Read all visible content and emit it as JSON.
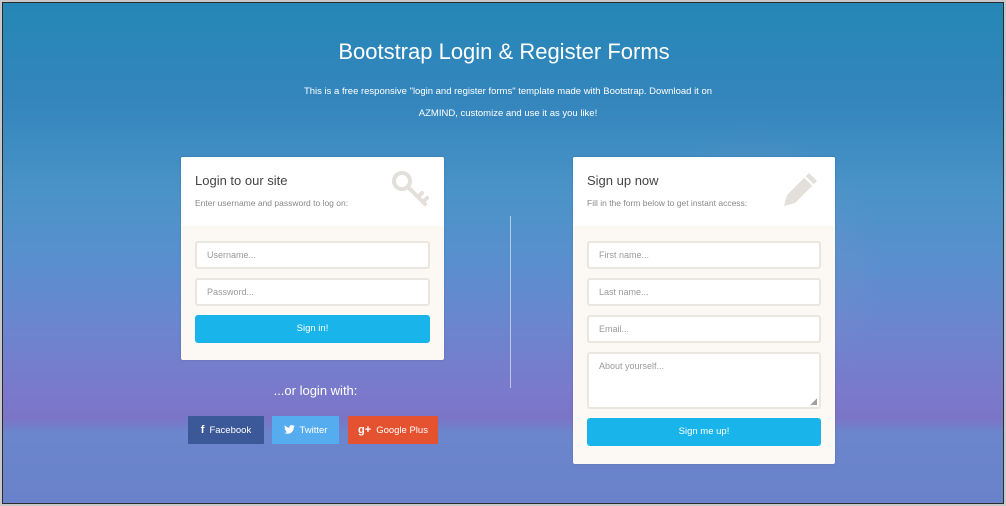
{
  "header": {
    "title": "Bootstrap Login & Register Forms",
    "description_line1": "This is a free responsive \"login and register forms\" template made with Bootstrap. Download it on",
    "description_line2": "AZMIND, customize and use it as you like!"
  },
  "login": {
    "title": "Login to our site",
    "subtitle": "Enter username and password to log on:",
    "icon": "key-icon",
    "username_placeholder": "Username...",
    "password_placeholder": "Password...",
    "submit_label": "Sign in!"
  },
  "social": {
    "or_text": "...or login with:",
    "buttons": [
      {
        "label": "Facebook",
        "icon": "facebook-icon",
        "glyph": "f",
        "color": "#3b5998"
      },
      {
        "label": "Twitter",
        "icon": "twitter-icon",
        "glyph": "🐦",
        "color": "#55acee"
      },
      {
        "label": "Google Plus",
        "icon": "google-plus-icon",
        "glyph": "g+",
        "color": "#e45230"
      }
    ]
  },
  "signup": {
    "title": "Sign up now",
    "subtitle": "Fill in the form below to get instant access:",
    "icon": "pencil-icon",
    "first_name_placeholder": "First name...",
    "last_name_placeholder": "Last name...",
    "email_placeholder": "Email...",
    "about_placeholder": "About yourself...",
    "submit_label": "Sign me up!"
  },
  "colors": {
    "primary_button": "#19b4ea",
    "card_body": "#fcf9f5",
    "facebook": "#3b5998",
    "twitter": "#55acee",
    "google_plus": "#e45230"
  }
}
